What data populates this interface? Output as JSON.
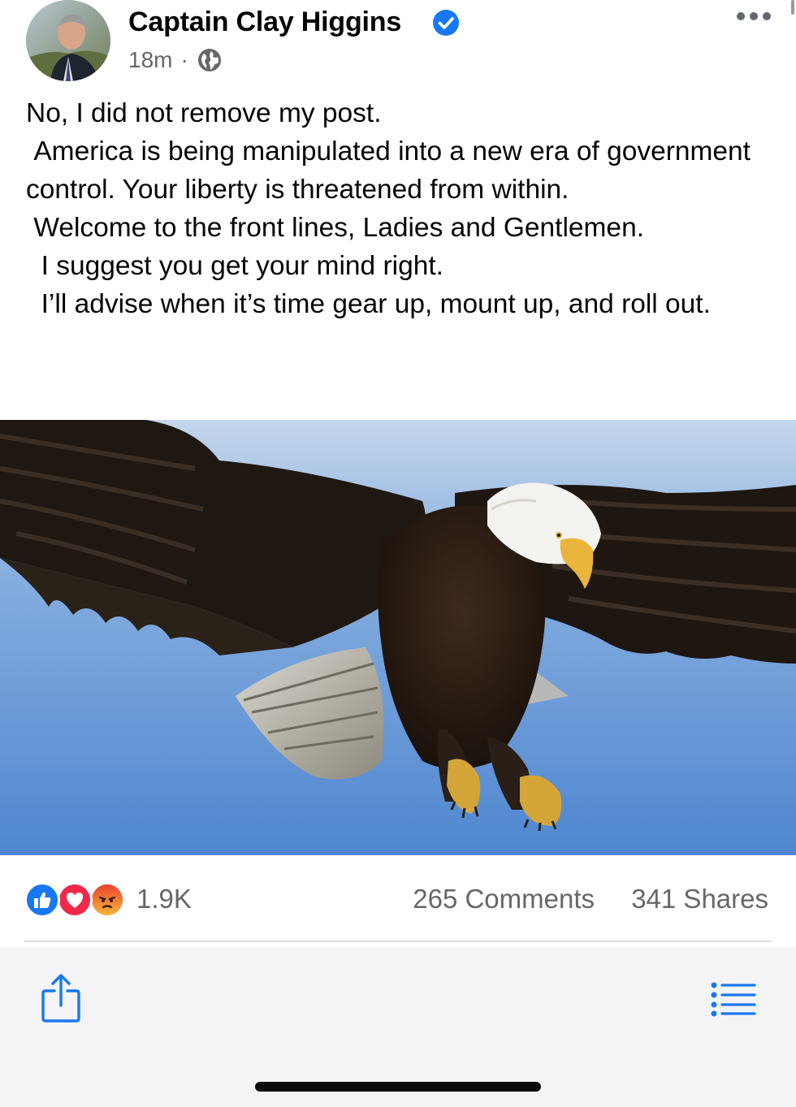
{
  "post": {
    "author": "Captain Clay Higgins",
    "timestamp": "18m",
    "separator": "·",
    "privacy_icon": "globe-icon",
    "verified_icon": "verified-badge-icon",
    "more_icon": "more-options-icon",
    "text": "No, I did not remove my post.\n America is being manipulated into a new era of government control. Your liberty is threatened from within.\n Welcome to the front lines, Ladies and Gentlemen.\n  I suggest you get your mind right.\n  I’ll advise when it’s time gear up, mount up, and roll out.",
    "image_subject": "bald-eagle-photo"
  },
  "engagement": {
    "reactions": [
      "like-icon",
      "love-icon",
      "angry-icon"
    ],
    "reaction_count": "1.9K",
    "comments": "265 Comments",
    "shares": "341 Shares"
  },
  "toolbar": {
    "left_icon": "share-icon",
    "right_icon": "list-icon"
  },
  "colors": {
    "accent": "#1877f2",
    "love": "#f02849",
    "angry": "#e9710f",
    "secondary_text": "#65676b",
    "sky": "#6a9ad6"
  }
}
